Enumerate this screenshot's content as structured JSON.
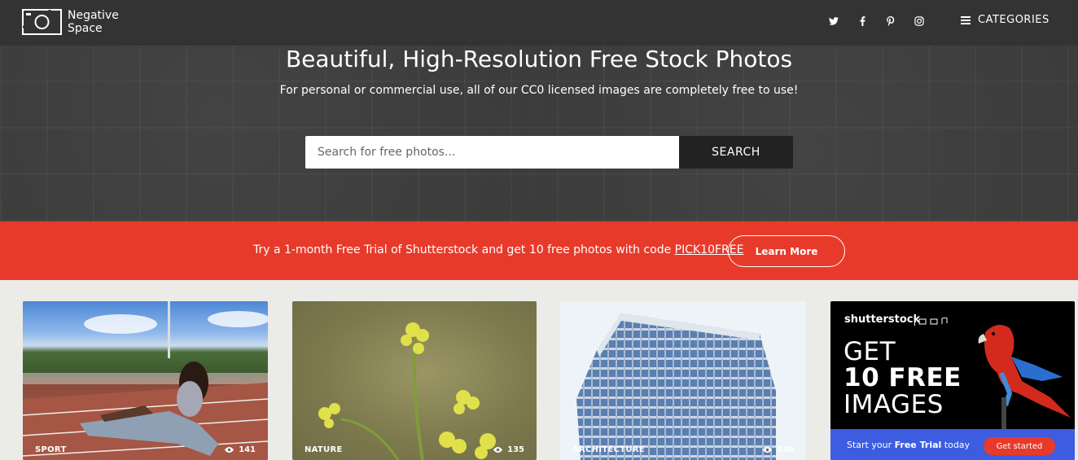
{
  "header": {
    "logo_line1": "Negative",
    "logo_line2": "Space",
    "social": [
      {
        "name": "twitter-icon"
      },
      {
        "name": "facebook-icon"
      },
      {
        "name": "pinterest-icon"
      },
      {
        "name": "instagram-icon"
      }
    ],
    "categories_label": "CATEGORIES"
  },
  "hero": {
    "title": "Beautiful, High-Resolution Free Stock Photos",
    "subtitle": "For personal or commercial use, all of our CC0 licensed images are completely free to use!",
    "search_placeholder": "Search for free photos...",
    "search_button": "SEARCH"
  },
  "promo": {
    "text": "Try a 1-month Free Trial of Shutterstock and get 10 free photos with code ",
    "code": "PICK10FREE",
    "button": "Learn More"
  },
  "cards": [
    {
      "label": "SPORT",
      "views": "141"
    },
    {
      "label": "NATURE",
      "views": "135"
    },
    {
      "label": "ARCHITECTURE",
      "views": "140"
    }
  ],
  "ad": {
    "brand": "shutterstock",
    "line1": "GET",
    "line2": "10 FREE",
    "line3": "IMAGES",
    "cta_prefix": "Start your ",
    "cta_bold": "Free Trial",
    "cta_suffix": " today",
    "cta_button": "Get started"
  },
  "colors": {
    "header_bg": "#333333",
    "promo_bg": "#e83a2a",
    "ad_blue": "#3d5ce0"
  }
}
